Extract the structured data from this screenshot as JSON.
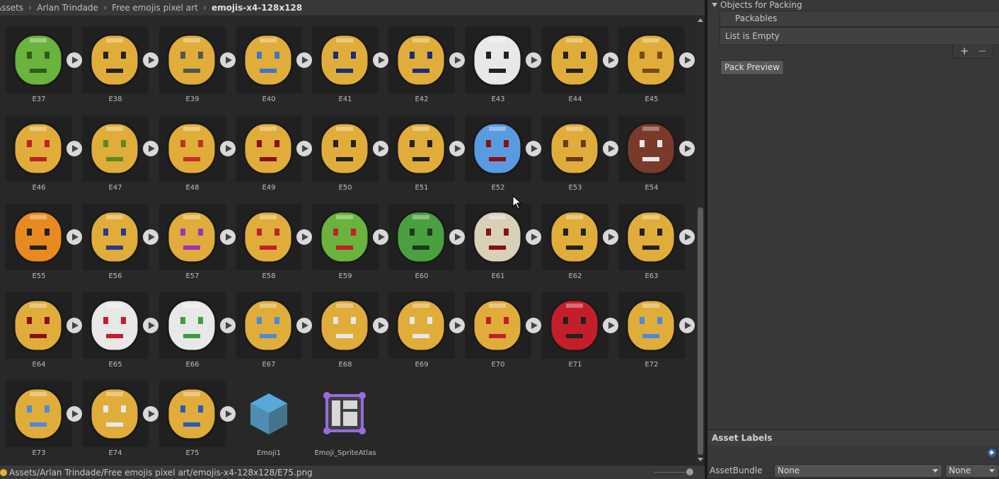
{
  "breadcrumb": [
    "Assets",
    "Arlan Trindade",
    "Free emojis pixel art",
    "emojis-x4-128x128"
  ],
  "emoji_tiles": [
    {
      "label": "E37",
      "face": "#6ab33c",
      "mark": "#2f5c1c"
    },
    {
      "label": "E38",
      "face": "#e0ad3a",
      "mark": "#222222"
    },
    {
      "label": "E39",
      "face": "#e0ad3a",
      "mark": "#555555"
    },
    {
      "label": "E40",
      "face": "#e0ad3a",
      "mark": "#3b78c8"
    },
    {
      "label": "E41",
      "face": "#e0ad3a",
      "mark": "#1c2c7a"
    },
    {
      "label": "E42",
      "face": "#e0ad3a",
      "mark": "#1c2c7a"
    },
    {
      "label": "E43",
      "face": "#e8e8e8",
      "mark": "#222222"
    },
    {
      "label": "E44",
      "face": "#e0ad3a",
      "mark": "#222222"
    },
    {
      "label": "E45",
      "face": "#e0ad3a",
      "mark": "#7a4a1a"
    },
    {
      "label": "E46",
      "face": "#e0ad3a",
      "mark": "#c41e2a"
    },
    {
      "label": "E47",
      "face": "#e0ad3a",
      "mark": "#5c8a20"
    },
    {
      "label": "E48",
      "face": "#e0ad3a",
      "mark": "#c43020"
    },
    {
      "label": "E49",
      "face": "#e0ad3a",
      "mark": "#8a1010"
    },
    {
      "label": "E50",
      "face": "#e0ad3a",
      "mark": "#222222"
    },
    {
      "label": "E51",
      "face": "#e0ad3a",
      "mark": "#222222"
    },
    {
      "label": "E52",
      "face": "#5a9ae0",
      "mark": "#8a1010"
    },
    {
      "label": "E53",
      "face": "#e0ad3a",
      "mark": "#6a3a1a"
    },
    {
      "label": "E54",
      "face": "#7a3a2a",
      "mark": "#e8e8e8"
    },
    {
      "label": "E55",
      "face": "#e88a20",
      "mark": "#222222"
    },
    {
      "label": "E56",
      "face": "#e0ad3a",
      "mark": "#2a3a8a"
    },
    {
      "label": "E57",
      "face": "#e0ad3a",
      "mark": "#a030c0"
    },
    {
      "label": "E58",
      "face": "#e0ad3a",
      "mark": "#c41e2a"
    },
    {
      "label": "E59",
      "face": "#6ab33c",
      "mark": "#c41e2a"
    },
    {
      "label": "E60",
      "face": "#4aa040",
      "mark": "#1a3a1a"
    },
    {
      "label": "E61",
      "face": "#d8d0b8",
      "mark": "#8a1010"
    },
    {
      "label": "E62",
      "face": "#e0ad3a",
      "mark": "#222222"
    },
    {
      "label": "E63",
      "face": "#e0ad3a",
      "mark": "#222222"
    },
    {
      "label": "E64",
      "face": "#e0ad3a",
      "mark": "#8a1010"
    },
    {
      "label": "E65",
      "face": "#e8e8e8",
      "mark": "#c41e2a"
    },
    {
      "label": "E66",
      "face": "#e8e8e8",
      "mark": "#3aa040"
    },
    {
      "label": "E67",
      "face": "#e0ad3a",
      "mark": "#4a8ae0"
    },
    {
      "label": "E68",
      "face": "#e0ad3a",
      "mark": "#e8e8e8"
    },
    {
      "label": "E69",
      "face": "#e0ad3a",
      "mark": "#e8e8e8"
    },
    {
      "label": "E70",
      "face": "#e0ad3a",
      "mark": "#c41e2a"
    },
    {
      "label": "E71",
      "face": "#c41e2a",
      "mark": "#222222"
    },
    {
      "label": "E72",
      "face": "#e0ad3a",
      "mark": "#4a8ae0"
    },
    {
      "label": "E73",
      "face": "#e0ad3a",
      "mark": "#4a8ae0"
    },
    {
      "label": "E74",
      "face": "#e0ad3a",
      "mark": "#e8e8e8"
    },
    {
      "label": "E75",
      "face": "#e0ad3a",
      "mark": "#2a5ac0"
    }
  ],
  "extra_assets": [
    {
      "label": "Emoji1",
      "icon": "prefab-cube-icon"
    },
    {
      "label": "Emoji_SpriteAtlas",
      "icon": "sprite-atlas-icon"
    }
  ],
  "status_path": "Assets/Arlan Trindade/Free emojis pixel art/emojis-x4-128x128/E75.png",
  "inspector": {
    "objects_for_packing": "Objects for Packing",
    "packables": "Packables",
    "list_empty": "List is Empty",
    "add_symbol": "+",
    "remove_symbol": "−",
    "pack_preview": "Pack Preview",
    "asset_labels": "Asset Labels",
    "asset_bundle_label": "AssetBundle",
    "asset_bundle_value": "None",
    "variant_value": "None"
  },
  "colors": {
    "accent_blue": "#2d5fa8",
    "cube_blue": "#5ab0e0",
    "atlas_purple": "#9a6ae0"
  }
}
